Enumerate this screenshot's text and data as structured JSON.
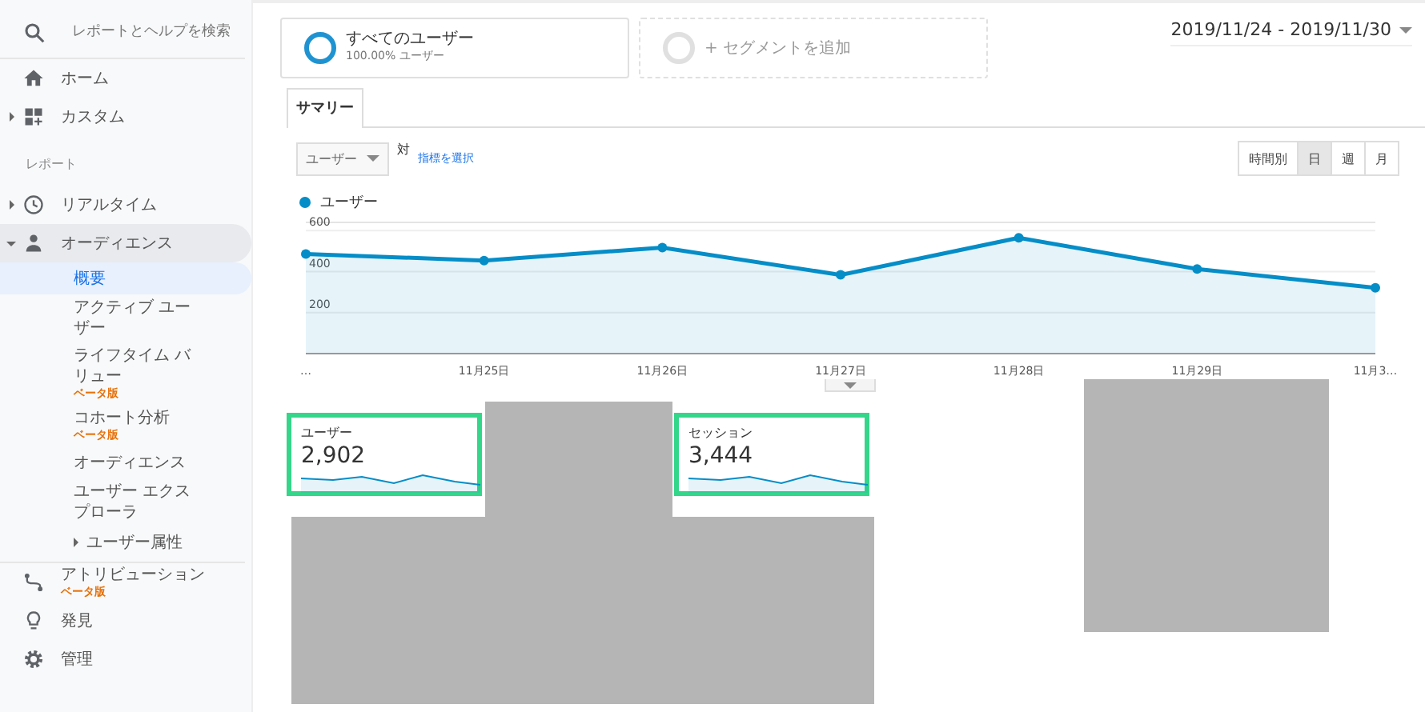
{
  "sidebar": {
    "search": {
      "placeholder": "レポートとヘルプを検索"
    },
    "items": [
      {
        "kind": "item",
        "label": "ホーム",
        "selected": false
      },
      {
        "kind": "item",
        "label": "カスタム",
        "expanded": false,
        "selected": false
      },
      {
        "kind": "label",
        "label": "レポート"
      },
      {
        "kind": "item",
        "label": "リアルタイム",
        "expanded": false,
        "selected": false
      },
      {
        "kind": "item",
        "label": "オーディエンス",
        "expanded": true,
        "selected": false,
        "children": [
          {
            "label": "概要",
            "selected": true
          },
          {
            "label": "アクティブ ユーザー",
            "selected": false
          },
          {
            "label": "ライフタイム バリュー",
            "badge": "ベータ版",
            "selected": false
          },
          {
            "label": "コホート分析",
            "badge": "ベータ版",
            "selected": false
          },
          {
            "label": "オーディエンス",
            "selected": false
          },
          {
            "label": "ユーザー エクスプローラ",
            "selected": false
          },
          {
            "label": "ユーザー属性",
            "expanded": false,
            "selected": false
          }
        ]
      },
      {
        "kind": "item",
        "label": "アトリビューション",
        "badge": "ベータ版",
        "selected": false
      },
      {
        "kind": "item",
        "label": "発見",
        "selected": false
      },
      {
        "kind": "item",
        "label": "管理",
        "selected": false
      }
    ]
  },
  "segments": [
    {
      "kind": "active",
      "title": "すべてのユーザー",
      "subtitle": "100.00% ユーザー"
    },
    {
      "kind": "add",
      "title": "+ セグメントを追加"
    }
  ],
  "date_range": "2019/11/24 - 2019/11/30",
  "tabs": [
    {
      "label": "サマリー",
      "selected": true
    }
  ],
  "metric": {
    "value": "ユーザー",
    "versus": "対",
    "link": "指標を選択"
  },
  "granularity": [
    {
      "label": "時間別",
      "selected": false
    },
    {
      "label": "日",
      "selected": true
    },
    {
      "label": "週",
      "selected": false
    },
    {
      "label": "月",
      "selected": false
    }
  ],
  "chart": {
    "chart_data": {
      "type": "area",
      "grid": true,
      "categories": [
        "…",
        "11月25日",
        "11月26日",
        "11月27日",
        "11月28日",
        "11月29日",
        "11月3…"
      ],
      "ylim": [
        0,
        640
      ],
      "yticks": [
        200,
        400,
        600
      ],
      "series": [
        {
          "name": "ユーザー",
          "color": "#058dc7",
          "values": [
            486,
            454,
            517,
            384,
            565,
            413,
            321
          ]
        }
      ]
    }
  },
  "scorecards": [
    {
      "label": "ユーザー",
      "value": "2,902",
      "highlighted": true
    },
    {
      "label": "セッション",
      "value": "3,444",
      "highlighted": true
    }
  ]
}
